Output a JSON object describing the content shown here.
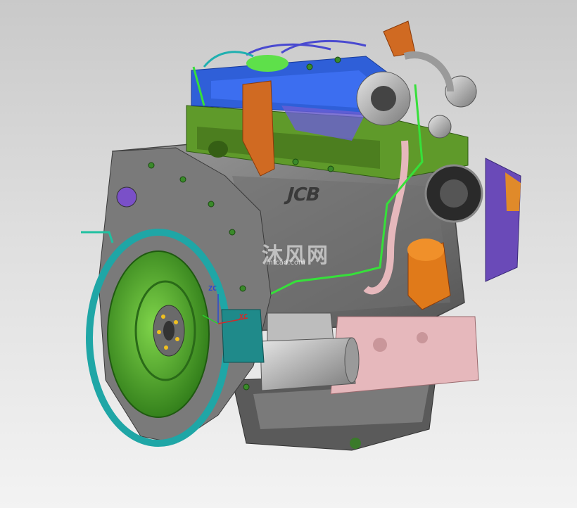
{
  "brand_badge": "JCB",
  "watermark": {
    "text": "沐风网",
    "url": "mfcad.com"
  },
  "axes": {
    "z": "ZC",
    "x": "XC"
  },
  "colors": {
    "valve_cover": "#2f5fd8",
    "head": "#5f9a2a",
    "block": "#8a8a8a",
    "flywheel": "#4caf2a",
    "housing_ring": "#1fa6a6",
    "bracket": "#d06a22",
    "sump": "#e6b8bc",
    "pipe": "#36e03a"
  }
}
